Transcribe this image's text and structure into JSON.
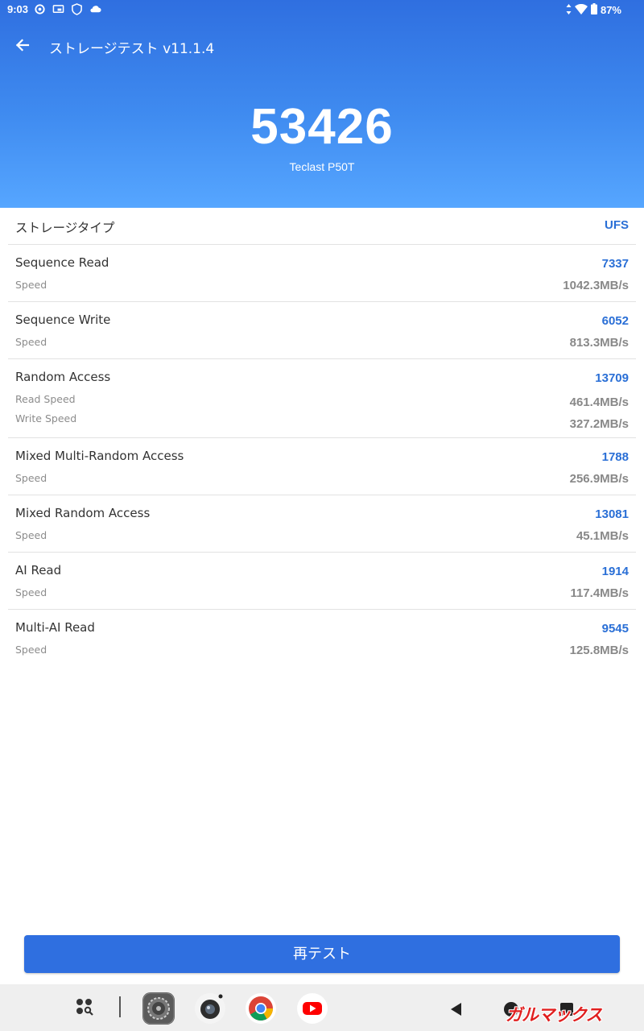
{
  "status_bar": {
    "time": "9:03",
    "battery": "87%"
  },
  "app_bar": {
    "title": "ストレージテスト v11.1.4"
  },
  "summary": {
    "total_score": "53426",
    "device": "Teclast P50T"
  },
  "storage_type": {
    "label": "ストレージタイプ",
    "value": "UFS"
  },
  "results": [
    {
      "title": "Sequence Read",
      "score": "7337",
      "metrics": [
        {
          "label": "Speed",
          "value": "1042.3MB/s"
        }
      ]
    },
    {
      "title": "Sequence Write",
      "score": "6052",
      "metrics": [
        {
          "label": "Speed",
          "value": "813.3MB/s"
        }
      ]
    },
    {
      "title": "Random Access",
      "score": "13709",
      "metrics": [
        {
          "label": "Read Speed",
          "value": "461.4MB/s"
        },
        {
          "label": "Write Speed",
          "value": "327.2MB/s"
        }
      ]
    },
    {
      "title": "Mixed Multi-Random Access",
      "score": "1788",
      "metrics": [
        {
          "label": "Speed",
          "value": "256.9MB/s"
        }
      ]
    },
    {
      "title": "Mixed Random Access",
      "score": "13081",
      "metrics": [
        {
          "label": "Speed",
          "value": "45.1MB/s"
        }
      ]
    },
    {
      "title": "AI Read",
      "score": "1914",
      "metrics": [
        {
          "label": "Speed",
          "value": "117.4MB/s"
        }
      ]
    },
    {
      "title": "Multi-AI Read",
      "score": "9545",
      "metrics": [
        {
          "label": "Speed",
          "value": "125.8MB/s"
        }
      ]
    }
  ],
  "retest_button": {
    "label": "再テスト"
  },
  "taskbar": {
    "icons": [
      "app-drawer-search-icon",
      "settings-app-icon",
      "camera-app-icon",
      "chrome-app-icon",
      "youtube-app-icon",
      "nav-back-icon",
      "nav-home-icon",
      "nav-recents-icon"
    ]
  },
  "watermark": {
    "text": "ガルマックス"
  },
  "colors": {
    "header_top": "#2f6fe0",
    "header_bottom": "#56a6ff",
    "accent": "#2a6fd6",
    "button": "#2f6fe0"
  }
}
